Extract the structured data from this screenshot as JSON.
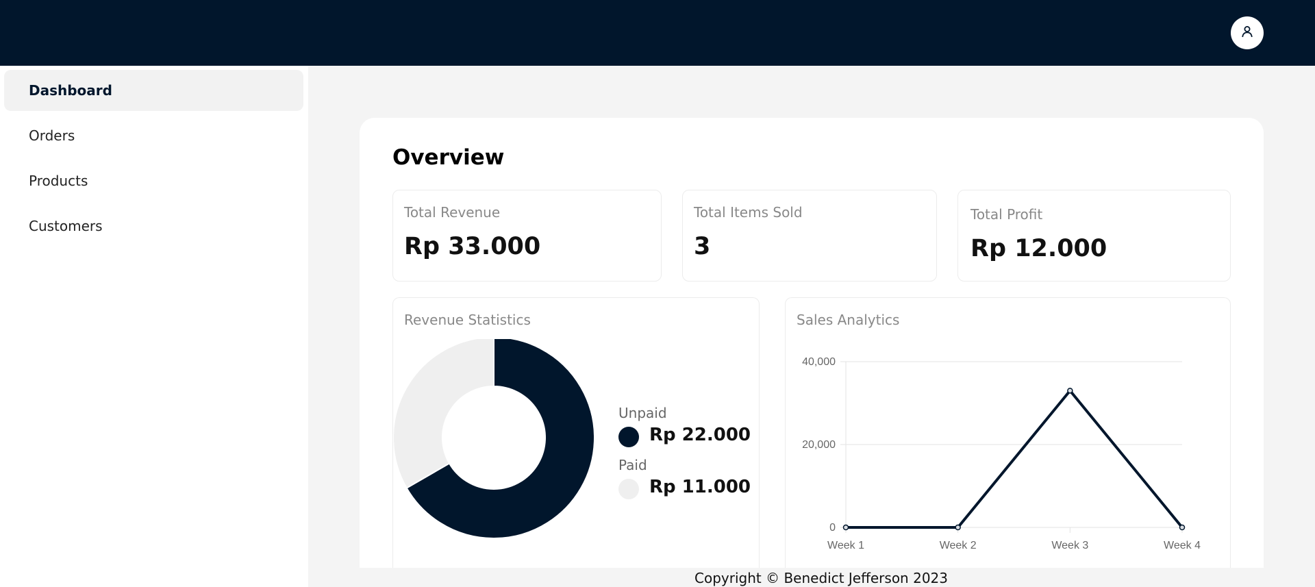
{
  "header": {
    "avatar_icon": "user-icon",
    "background": "#01162c"
  },
  "sidebar": {
    "items": [
      {
        "label": "Dashboard",
        "active": true
      },
      {
        "label": "Orders",
        "active": false
      },
      {
        "label": "Products",
        "active": false
      },
      {
        "label": "Customers",
        "active": false
      }
    ]
  },
  "main": {
    "title": "Overview",
    "stats": [
      {
        "label": "Total Revenue",
        "value": "Rp 33.000"
      },
      {
        "label": "Total Items Sold",
        "value": "3"
      },
      {
        "label": "Total Profit",
        "value": "Rp 12.000"
      }
    ],
    "revenue_statistics": {
      "title": "Revenue Statistics",
      "legend": [
        {
          "label": "Unpaid",
          "value": "Rp 22.000",
          "color": "#01162c"
        },
        {
          "label": "Paid",
          "value": "Rp 11.000",
          "color": "#efefef"
        }
      ]
    },
    "sales_analytics": {
      "title": "Sales Analytics"
    }
  },
  "chart_data": [
    {
      "type": "pie",
      "variant": "doughnut",
      "categories": [
        "Unpaid",
        "Paid"
      ],
      "values": [
        22000,
        11000
      ],
      "colors": [
        "#01162c",
        "#efefef"
      ]
    },
    {
      "type": "line",
      "x": [
        "Week 1",
        "Week 2",
        "Week 3",
        "Week 4"
      ],
      "series": [
        {
          "values": [
            0,
            0,
            33000,
            0
          ],
          "color": "#01162c"
        }
      ],
      "ylim": [
        0,
        40000
      ],
      "yticks": [
        "0",
        "20,000",
        "40,000"
      ],
      "grid": true
    }
  ],
  "footer": {
    "copyright": "Copyright © Benedict Jefferson 2023"
  }
}
